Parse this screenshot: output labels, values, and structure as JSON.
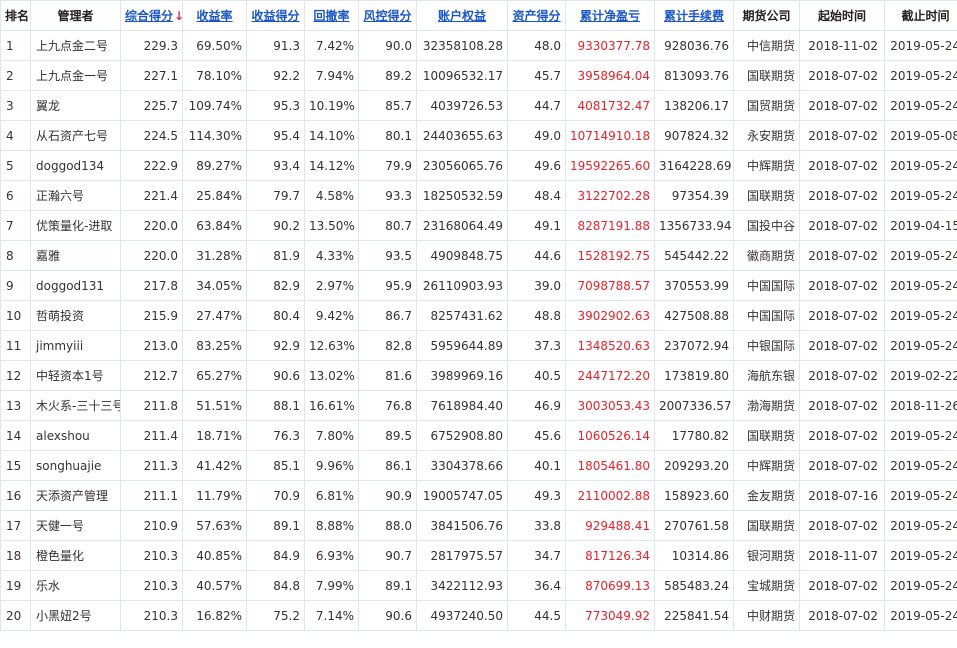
{
  "table": {
    "headers": {
      "rank": "排名",
      "manager": "管理者",
      "composite": "综合得分",
      "sort_arrow": "↓",
      "return_rate": "收益率",
      "return_score": "收益得分",
      "drawdown": "回撤率",
      "risk_score": "风控得分",
      "equity": "账户权益",
      "asset_score": "资产得分",
      "net_pnl": "累计净盈亏",
      "fees": "累计手续费",
      "broker": "期货公司",
      "start": "起始时间",
      "end": "截止时间"
    },
    "rows": [
      {
        "rank": "1",
        "manager": "上九点金二号",
        "composite": "229.3",
        "return_rate": "69.50%",
        "return_score": "91.3",
        "drawdown": "7.42%",
        "risk_score": "90.0",
        "equity": "32358108.28",
        "asset_score": "48.0",
        "net_pnl": "9330377.78",
        "fees": "928036.76",
        "broker": "中信期货",
        "start": "2018-11-02",
        "end": "2019-05-24"
      },
      {
        "rank": "2",
        "manager": "上九点金一号",
        "composite": "227.1",
        "return_rate": "78.10%",
        "return_score": "92.2",
        "drawdown": "7.94%",
        "risk_score": "89.2",
        "equity": "10096532.17",
        "asset_score": "45.7",
        "net_pnl": "3958964.04",
        "fees": "813093.76",
        "broker": "国联期货",
        "start": "2018-07-02",
        "end": "2019-05-24"
      },
      {
        "rank": "3",
        "manager": "翼龙",
        "composite": "225.7",
        "return_rate": "109.74%",
        "return_score": "95.3",
        "drawdown": "10.19%",
        "risk_score": "85.7",
        "equity": "4039726.53",
        "asset_score": "44.7",
        "net_pnl": "4081732.47",
        "fees": "138206.17",
        "broker": "国贸期货",
        "start": "2018-07-02",
        "end": "2019-05-24"
      },
      {
        "rank": "4",
        "manager": "从石资产七号",
        "composite": "224.5",
        "return_rate": "114.30%",
        "return_score": "95.4",
        "drawdown": "14.10%",
        "risk_score": "80.1",
        "equity": "24403655.63",
        "asset_score": "49.0",
        "net_pnl": "10714910.18",
        "fees": "907824.32",
        "broker": "永安期货",
        "start": "2018-07-02",
        "end": "2019-05-08"
      },
      {
        "rank": "5",
        "manager": "doggod134",
        "composite": "222.9",
        "return_rate": "89.27%",
        "return_score": "93.4",
        "drawdown": "14.12%",
        "risk_score": "79.9",
        "equity": "23056065.76",
        "asset_score": "49.6",
        "net_pnl": "19592265.60",
        "fees": "3164228.69",
        "broker": "中辉期货",
        "start": "2018-07-02",
        "end": "2019-05-24"
      },
      {
        "rank": "6",
        "manager": "正瀚六号",
        "composite": "221.4",
        "return_rate": "25.84%",
        "return_score": "79.7",
        "drawdown": "4.58%",
        "risk_score": "93.3",
        "equity": "18250532.59",
        "asset_score": "48.4",
        "net_pnl": "3122702.28",
        "fees": "97354.39",
        "broker": "国联期货",
        "start": "2018-07-02",
        "end": "2019-05-24"
      },
      {
        "rank": "7",
        "manager": "优策量化-进取",
        "composite": "220.0",
        "return_rate": "63.84%",
        "return_score": "90.2",
        "drawdown": "13.50%",
        "risk_score": "80.7",
        "equity": "23168064.49",
        "asset_score": "49.1",
        "net_pnl": "8287191.88",
        "fees": "1356733.94",
        "broker": "国投中谷",
        "start": "2018-07-02",
        "end": "2019-04-15"
      },
      {
        "rank": "8",
        "manager": "嘉雅",
        "composite": "220.0",
        "return_rate": "31.28%",
        "return_score": "81.9",
        "drawdown": "4.33%",
        "risk_score": "93.5",
        "equity": "4909848.75",
        "asset_score": "44.6",
        "net_pnl": "1528192.75",
        "fees": "545442.22",
        "broker": "徽商期货",
        "start": "2018-07-02",
        "end": "2019-05-24"
      },
      {
        "rank": "9",
        "manager": "doggod131",
        "composite": "217.8",
        "return_rate": "34.05%",
        "return_score": "82.9",
        "drawdown": "2.97%",
        "risk_score": "95.9",
        "equity": "26110903.93",
        "asset_score": "39.0",
        "net_pnl": "7098788.57",
        "fees": "370553.99",
        "broker": "中国国际",
        "start": "2018-07-02",
        "end": "2019-05-24"
      },
      {
        "rank": "10",
        "manager": "哲萌投资",
        "composite": "215.9",
        "return_rate": "27.47%",
        "return_score": "80.4",
        "drawdown": "9.42%",
        "risk_score": "86.7",
        "equity": "8257431.62",
        "asset_score": "48.8",
        "net_pnl": "3902902.63",
        "fees": "427508.88",
        "broker": "中国国际",
        "start": "2018-07-02",
        "end": "2019-05-24"
      },
      {
        "rank": "11",
        "manager": "jimmyiii",
        "composite": "213.0",
        "return_rate": "83.25%",
        "return_score": "92.9",
        "drawdown": "12.63%",
        "risk_score": "82.8",
        "equity": "5959644.89",
        "asset_score": "37.3",
        "net_pnl": "1348520.63",
        "fees": "237072.94",
        "broker": "中银国际",
        "start": "2018-07-02",
        "end": "2019-05-24"
      },
      {
        "rank": "12",
        "manager": "中轻资本1号",
        "composite": "212.7",
        "return_rate": "65.27%",
        "return_score": "90.6",
        "drawdown": "13.02%",
        "risk_score": "81.6",
        "equity": "3989969.16",
        "asset_score": "40.5",
        "net_pnl": "2447172.20",
        "fees": "173819.80",
        "broker": "海航东银",
        "start": "2018-07-02",
        "end": "2019-02-22"
      },
      {
        "rank": "13",
        "manager": "木火系-三十三号",
        "composite": "211.8",
        "return_rate": "51.51%",
        "return_score": "88.1",
        "drawdown": "16.61%",
        "risk_score": "76.8",
        "equity": "7618984.40",
        "asset_score": "46.9",
        "net_pnl": "3003053.43",
        "fees": "2007336.57",
        "broker": "渤海期货",
        "start": "2018-07-02",
        "end": "2018-11-26"
      },
      {
        "rank": "14",
        "manager": "alexshou",
        "composite": "211.4",
        "return_rate": "18.71%",
        "return_score": "76.3",
        "drawdown": "7.80%",
        "risk_score": "89.5",
        "equity": "6752908.80",
        "asset_score": "45.6",
        "net_pnl": "1060526.14",
        "fees": "17780.82",
        "broker": "国联期货",
        "start": "2018-07-02",
        "end": "2019-05-24"
      },
      {
        "rank": "15",
        "manager": "songhuajie",
        "composite": "211.3",
        "return_rate": "41.42%",
        "return_score": "85.1",
        "drawdown": "9.96%",
        "risk_score": "86.1",
        "equity": "3304378.66",
        "asset_score": "40.1",
        "net_pnl": "1805461.80",
        "fees": "209293.20",
        "broker": "中辉期货",
        "start": "2018-07-02",
        "end": "2019-05-24"
      },
      {
        "rank": "16",
        "manager": "天添资产管理",
        "composite": "211.1",
        "return_rate": "11.79%",
        "return_score": "70.9",
        "drawdown": "6.81%",
        "risk_score": "90.9",
        "equity": "19005747.05",
        "asset_score": "49.3",
        "net_pnl": "2110002.88",
        "fees": "158923.60",
        "broker": "金友期货",
        "start": "2018-07-16",
        "end": "2019-05-24"
      },
      {
        "rank": "17",
        "manager": "天健一号",
        "composite": "210.9",
        "return_rate": "57.63%",
        "return_score": "89.1",
        "drawdown": "8.88%",
        "risk_score": "88.0",
        "equity": "3841506.76",
        "asset_score": "33.8",
        "net_pnl": "929488.41",
        "fees": "270761.58",
        "broker": "国联期货",
        "start": "2018-07-02",
        "end": "2019-05-24"
      },
      {
        "rank": "18",
        "manager": "橙色量化",
        "composite": "210.3",
        "return_rate": "40.85%",
        "return_score": "84.9",
        "drawdown": "6.93%",
        "risk_score": "90.7",
        "equity": "2817975.57",
        "asset_score": "34.7",
        "net_pnl": "817126.34",
        "fees": "10314.86",
        "broker": "银河期货",
        "start": "2018-11-07",
        "end": "2019-05-24"
      },
      {
        "rank": "19",
        "manager": "乐水",
        "composite": "210.3",
        "return_rate": "40.57%",
        "return_score": "84.8",
        "drawdown": "7.99%",
        "risk_score": "89.1",
        "equity": "3422112.93",
        "asset_score": "36.4",
        "net_pnl": "870699.13",
        "fees": "585483.24",
        "broker": "宝城期货",
        "start": "2018-07-02",
        "end": "2019-05-24"
      },
      {
        "rank": "20",
        "manager": "小黑妞2号",
        "composite": "210.3",
        "return_rate": "16.82%",
        "return_score": "75.2",
        "drawdown": "7.14%",
        "risk_score": "90.6",
        "equity": "4937240.50",
        "asset_score": "44.5",
        "net_pnl": "773049.92",
        "fees": "225841.54",
        "broker": "中财期货",
        "start": "2018-07-02",
        "end": "2019-05-24"
      }
    ]
  },
  "colors": {
    "link": "#1a56c9",
    "pnl": "#e8222b",
    "sort_arrow": "#e03030",
    "border": "#dfe6ee"
  }
}
